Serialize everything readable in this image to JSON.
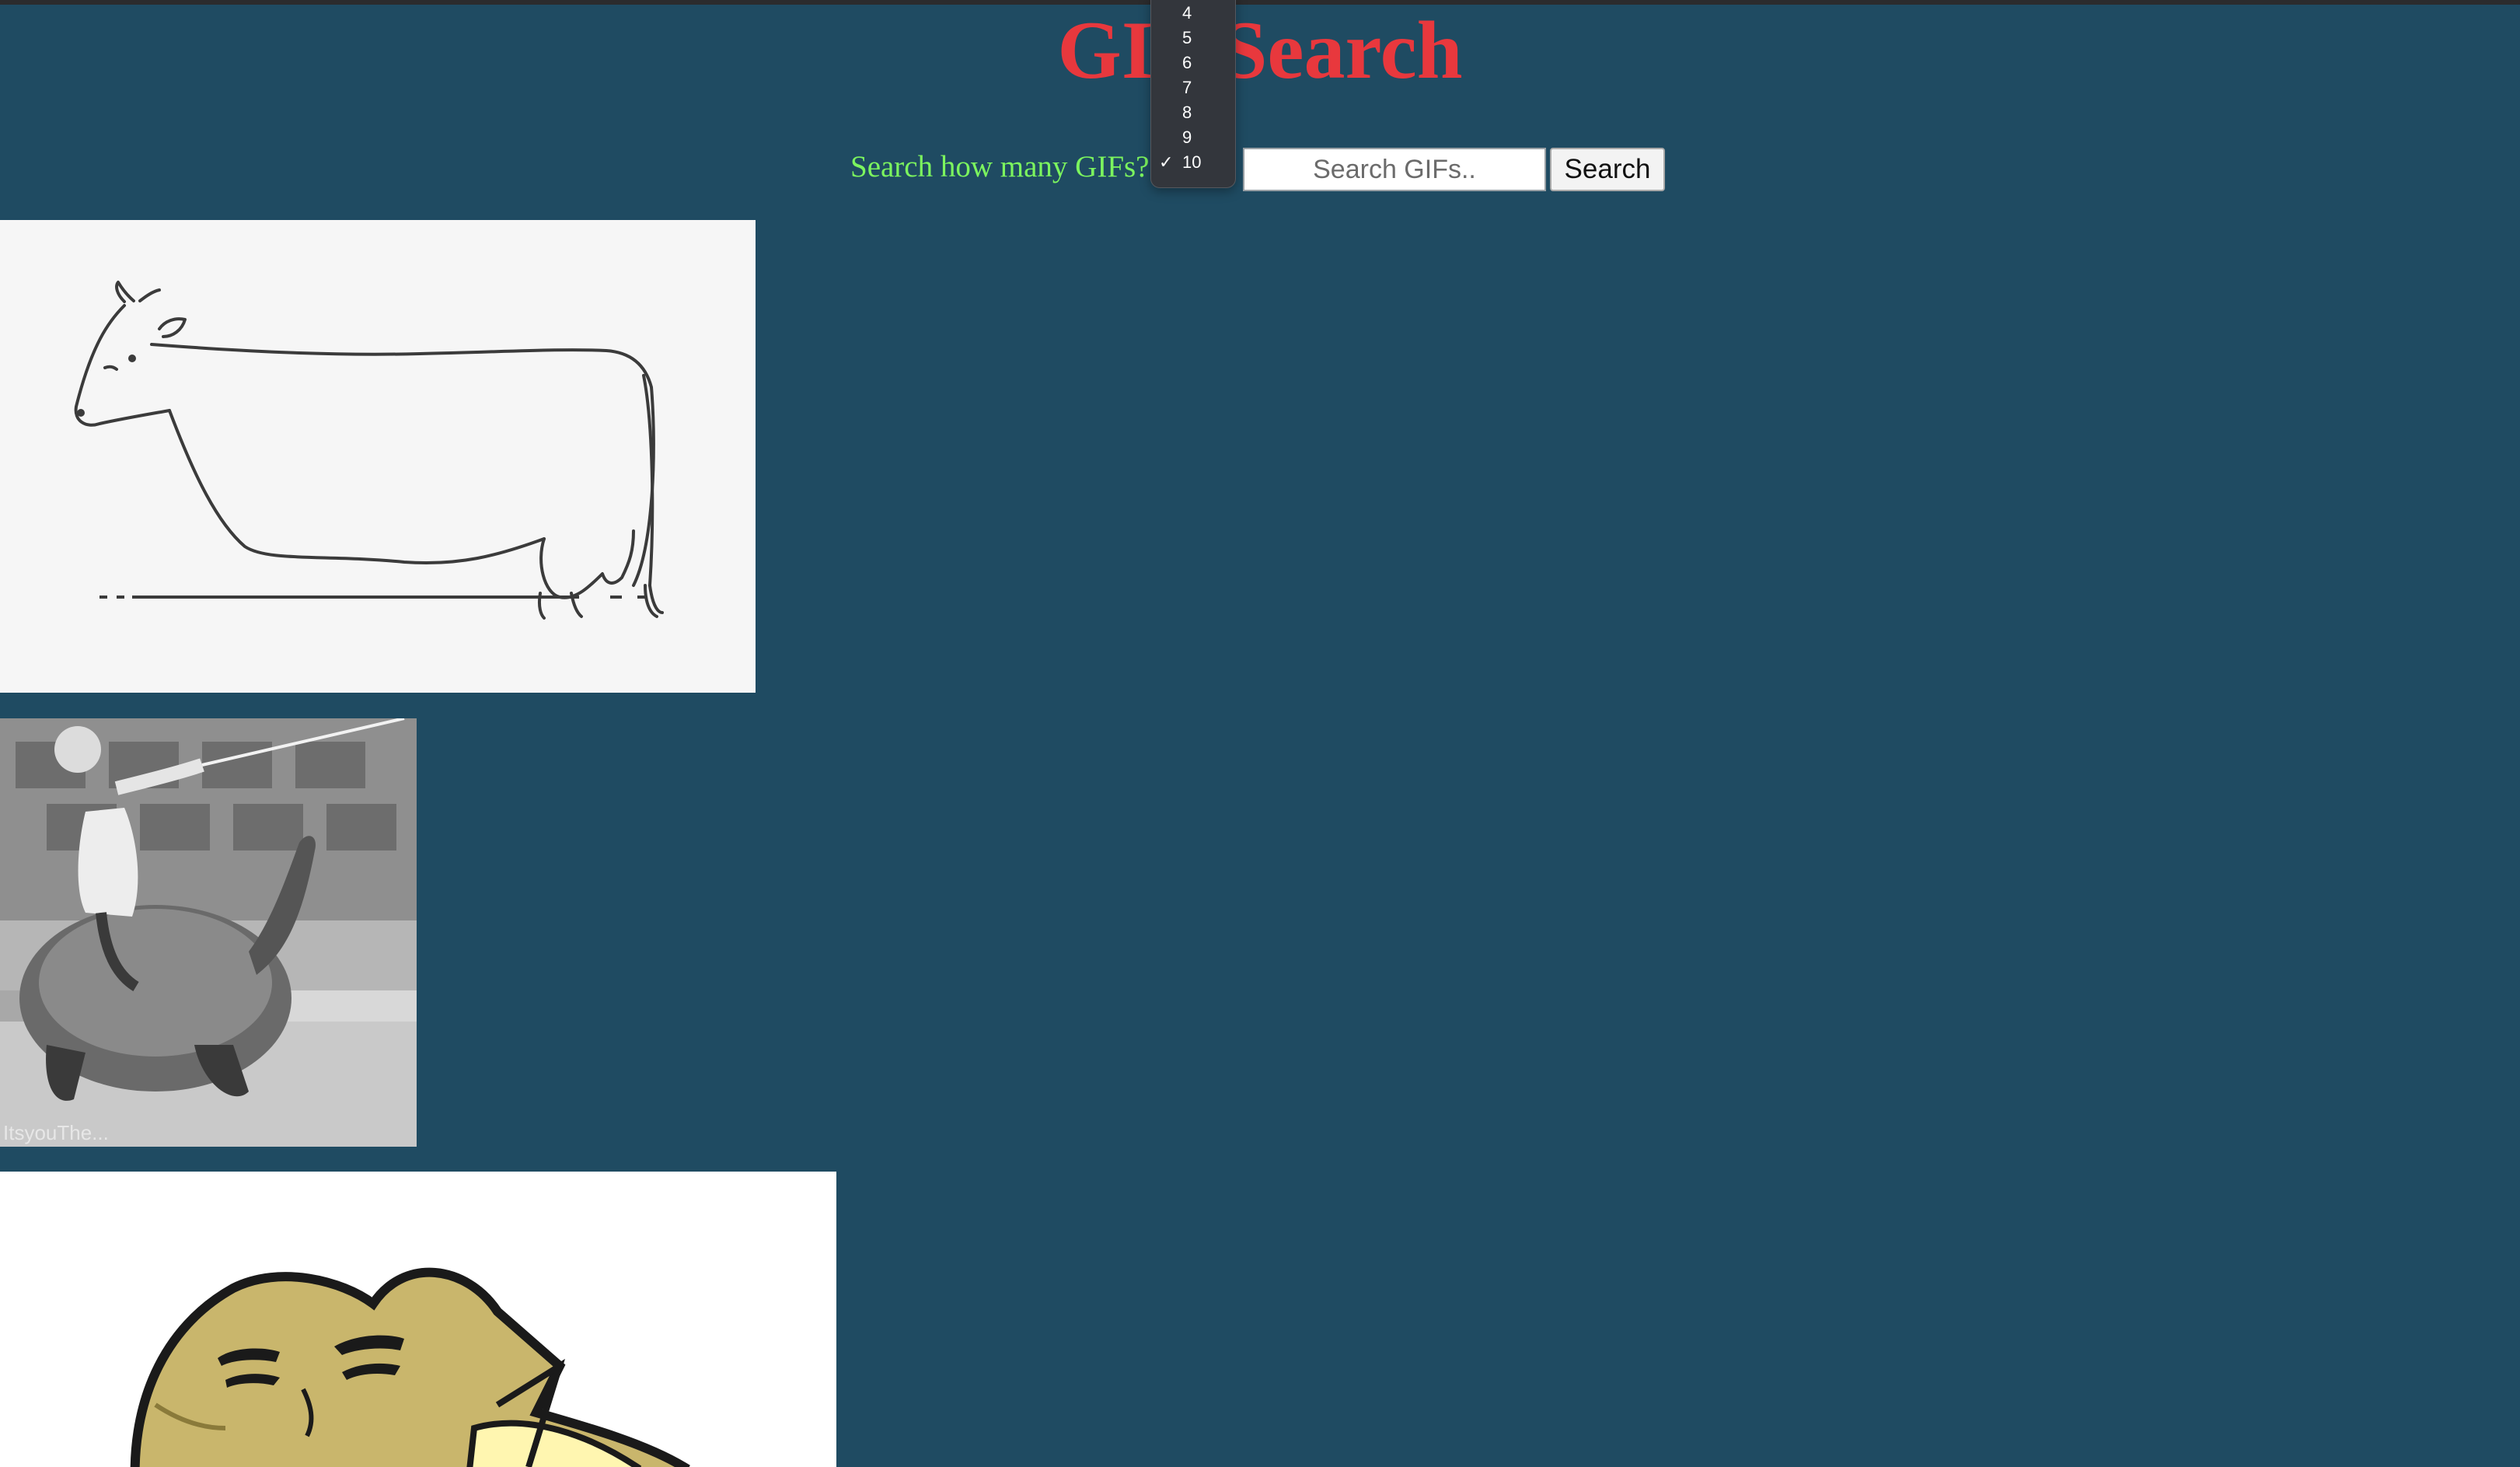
{
  "page": {
    "title": "GIF Search",
    "background_color": "#1f4b62",
    "title_color": "#e8383d",
    "label_color": "#7cf55e"
  },
  "search": {
    "count_label": "Search how many GIFs?",
    "placeholder": "Search GIFs..",
    "value": "",
    "button_label": "Search"
  },
  "count_select": {
    "state": "open",
    "selected": "10",
    "visible_options": [
      "4",
      "5",
      "6",
      "7",
      "8",
      "9",
      "10"
    ],
    "check_mark": "✓"
  },
  "gifs": [
    {
      "name": "cow-line-drawing-gif",
      "subject": "line drawing of a cow"
    },
    {
      "name": "tortoise-rider-gif",
      "subject": "black and white photo of a child riding a giant tortoise",
      "caption": "ItsyouThe..."
    },
    {
      "name": "cartoon-faces-gif",
      "subject": "yellow cartoon blob with faces"
    }
  ]
}
